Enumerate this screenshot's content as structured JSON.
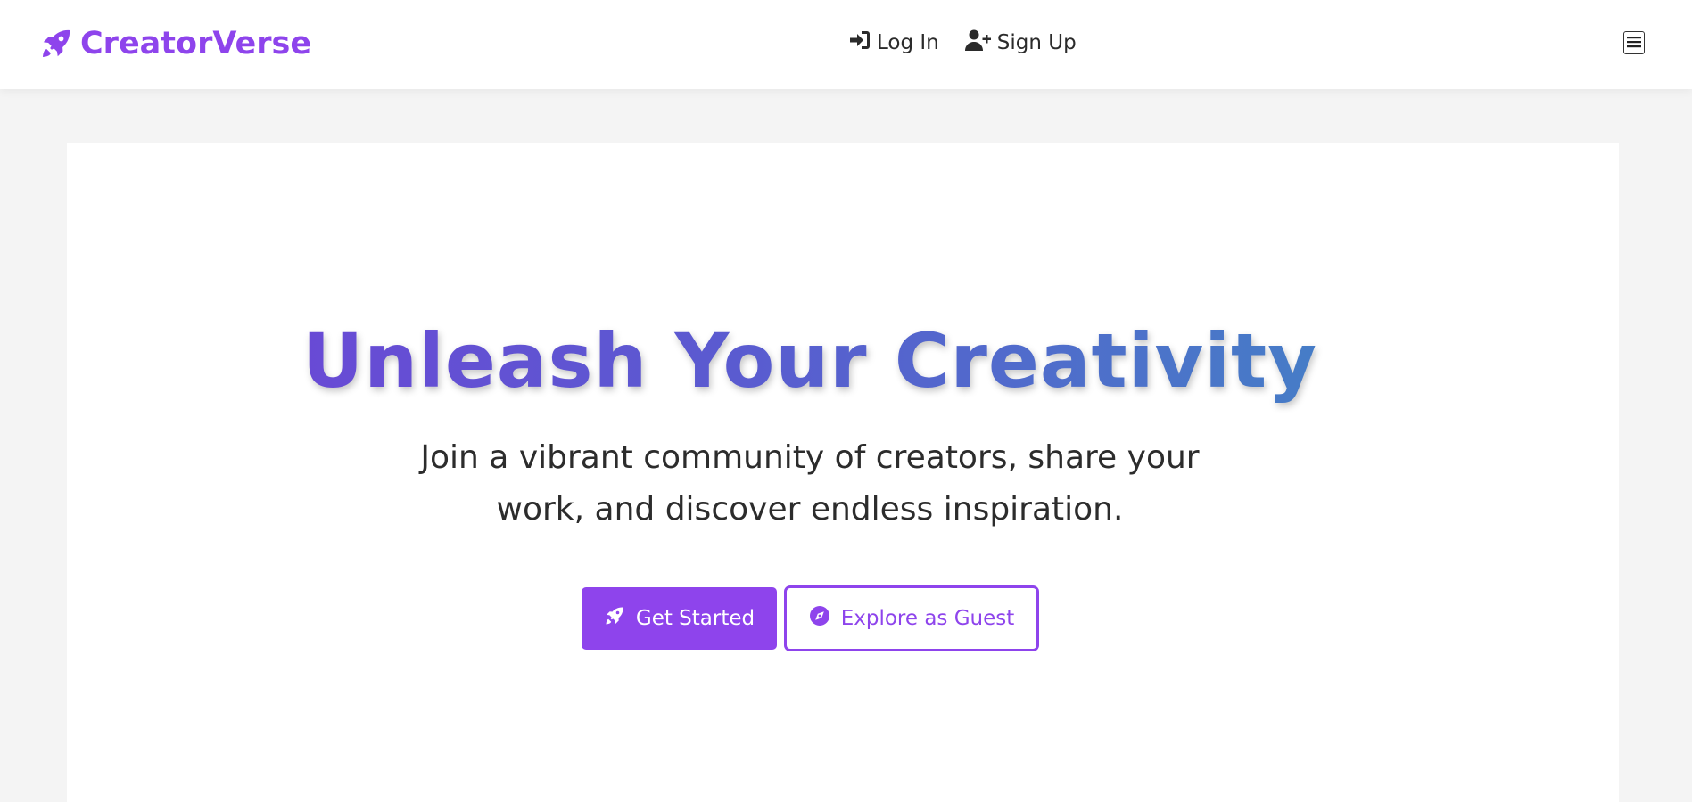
{
  "navbar": {
    "brand_name": "CreatorVerse",
    "brand_icon": "rocket-icon",
    "links": [
      {
        "label": "Log In",
        "icon": "login-icon"
      },
      {
        "label": "Sign Up",
        "icon": "user-plus-icon"
      }
    ],
    "menu_icon": "hamburger-menu-icon"
  },
  "hero": {
    "title": "Unleash Your Creativity",
    "subtitle_line1": "Join a vibrant community of creators, share your",
    "subtitle_line2": "work, and discover endless inspiration.",
    "primary_button": {
      "label": "Get Started",
      "icon": "rocket-icon"
    },
    "secondary_button": {
      "label": "Explore as Guest",
      "icon": "compass-icon"
    }
  },
  "colors": {
    "brand": "#8e44ec",
    "title_gradient_start": "#7041d8",
    "title_gradient_end": "#3e8ac3",
    "page_background": "#f4f4f4",
    "text": "#2c2c2c"
  }
}
